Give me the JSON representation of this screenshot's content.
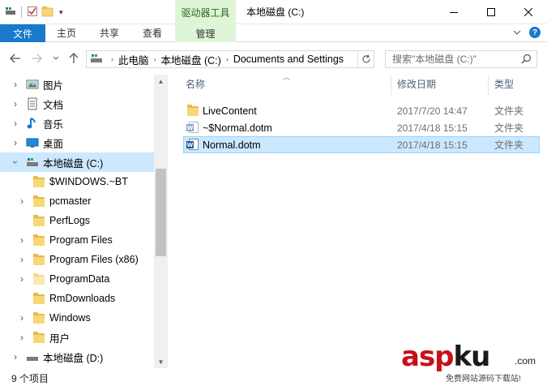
{
  "window": {
    "title": "本地磁盘 (C:)",
    "contextual_tool_group": "驱动器工具"
  },
  "ribbon": {
    "tabs": [
      {
        "label": "文件"
      },
      {
        "label": "主页"
      },
      {
        "label": "共享"
      },
      {
        "label": "查看"
      },
      {
        "label": "管理"
      }
    ]
  },
  "address_bar": {
    "segments": [
      "此电脑",
      "本地磁盘 (C:)",
      "Documents and Settings"
    ]
  },
  "search": {
    "placeholder": "搜索\"本地磁盘 (C:)\""
  },
  "nav_pane": {
    "items": [
      {
        "label": "图片",
        "icon": "pictures-icon",
        "expandable": true
      },
      {
        "label": "文档",
        "icon": "documents-icon",
        "expandable": true
      },
      {
        "label": "音乐",
        "icon": "music-icon",
        "expandable": true
      },
      {
        "label": "桌面",
        "icon": "desktop-icon",
        "expandable": true
      },
      {
        "label": "本地磁盘 (C:)",
        "icon": "drive-icon",
        "expandable": true,
        "expanded": true,
        "selected": true
      },
      {
        "label": "$WINDOWS.~BT",
        "icon": "folder-icon",
        "expandable": false
      },
      {
        "label": "pcmaster",
        "icon": "folder-icon",
        "expandable": true
      },
      {
        "label": "PerfLogs",
        "icon": "folder-icon",
        "expandable": false
      },
      {
        "label": "Program Files",
        "icon": "folder-icon",
        "expandable": true
      },
      {
        "label": "Program Files (x86)",
        "icon": "folder-icon",
        "expandable": true
      },
      {
        "label": "ProgramData",
        "icon": "folder-icon",
        "expandable": true
      },
      {
        "label": "RmDownloads",
        "icon": "folder-icon",
        "expandable": false
      },
      {
        "label": "Windows",
        "icon": "folder-icon",
        "expandable": true
      },
      {
        "label": "用户",
        "icon": "folder-icon",
        "expandable": true
      },
      {
        "label": "本地磁盘 (D:)",
        "icon": "drive-icon",
        "expandable": true
      }
    ]
  },
  "file_list": {
    "columns": {
      "name": "名称",
      "date": "修改日期",
      "type": "类型"
    },
    "rows": [
      {
        "name": "LiveContent",
        "date": "2017/7/20 14:47",
        "type": "文件夹",
        "icon": "folder-icon"
      },
      {
        "name": "~$Normal.dotm",
        "date": "2017/4/18 15:15",
        "type": "文件夹",
        "icon": "word-template-icon"
      },
      {
        "name": "Normal.dotm",
        "date": "2017/4/18 15:15",
        "type": "文件夹",
        "icon": "word-template-icon",
        "selected": true
      }
    ]
  },
  "status_bar": {
    "item_count": "9 个项目"
  },
  "watermark": {
    "brand_a": "asp",
    "brand_b": "ku",
    "suffix": ".com",
    "tagline": "免费网站源码下载站!"
  },
  "colors": {
    "accent": "#1979ca",
    "tool_tab": "#dff5d7",
    "selection": "#cce8ff"
  }
}
